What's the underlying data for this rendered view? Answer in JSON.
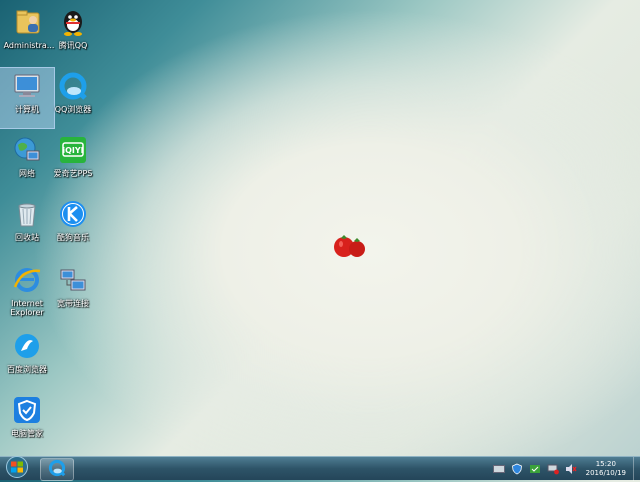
{
  "desktop_icons": [
    {
      "id": "administrator",
      "label": "Administra...",
      "icon": "folder-user-icon"
    },
    {
      "id": "qq",
      "label": "腾讯QQ",
      "icon": "qq-penguin-icon"
    },
    {
      "id": "computer",
      "label": "计算机",
      "icon": "computer-icon",
      "selected": true
    },
    {
      "id": "qq-browser",
      "label": "QQ浏览器",
      "icon": "qq-browser-icon"
    },
    {
      "id": "network",
      "label": "网络",
      "icon": "network-icon"
    },
    {
      "id": "iqiyi",
      "label": "爱奇艺PPS",
      "icon": "iqiyi-icon"
    },
    {
      "id": "recycle-bin",
      "label": "回收站",
      "icon": "recycle-bin-icon"
    },
    {
      "id": "kugou",
      "label": "酷狗音乐",
      "icon": "kugou-icon"
    },
    {
      "id": "ie",
      "label": "Internet Explorer",
      "icon": "internet-explorer-icon"
    },
    {
      "id": "broadband",
      "label": "宽带连接",
      "icon": "broadband-connection-icon"
    },
    {
      "id": "2345-browser",
      "label": "百度浏览器",
      "icon": "browser-icon"
    },
    {
      "id": "pc-manager",
      "label": "电脑管家",
      "icon": "pc-manager-shield-icon"
    }
  ],
  "taskbar": {
    "start_icon": "windows-start-icon",
    "pinned_app_icon": "qq-browser-icon"
  },
  "tray": {
    "icons": [
      "keyboard-icon",
      "shield-icon",
      "security-icon",
      "network-icon",
      "volume-muted-icon"
    ],
    "time": "15:20",
    "date": "2016/10/19"
  },
  "colors": {
    "taskbar": "#2e5468",
    "label_text": "#ffffff"
  }
}
